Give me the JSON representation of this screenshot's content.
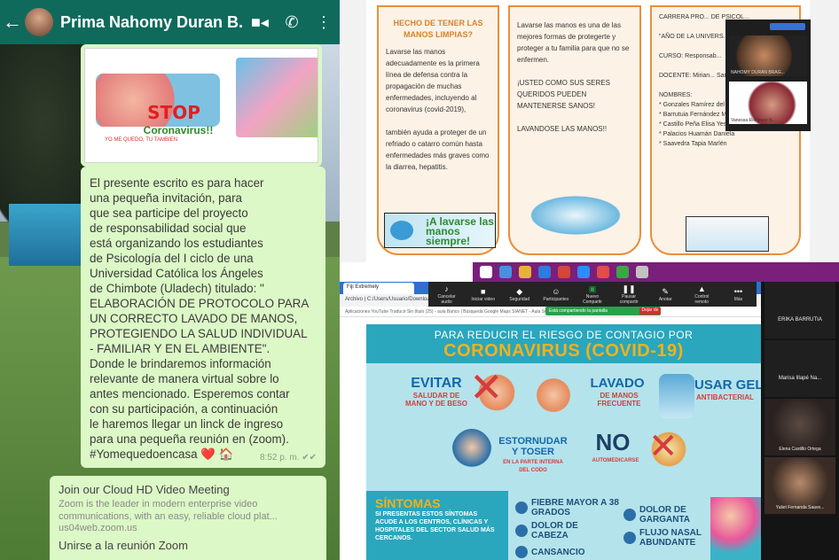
{
  "whatsapp": {
    "contact_name": "Prima Nahomy Duran B...",
    "poster": {
      "stop": "STOP",
      "coronavirus": "Coronavirus!!",
      "footer": "YO ME QUEDO, TU TAMBIEN"
    },
    "message": "El presente escrito es para hacer\nuna pequeña invitación, para\nque sea participe del proyecto\nde responsabilidad social que\nestá organizando los estudiantes\nde Psicología del I ciclo de una\nUniversidad Católica los Ángeles\nde Chimbote (Uladech) titulado: \"\nELABORACIÓN DE PROTOCOLO PARA\nUN CORRECTO LAVADO DE MANOS,\nPROTEGIENDO LA SALUD INDIVIDUAL\n- FAMILIAR Y EN EL AMBIENTE\".\nDonde le brindaremos información\nrelevante de manera virtual sobre lo\nantes mencionado. Esperemos contar\ncon su participación, a continuación\nle haremos llegar un linck de ingreso\npara una pequeña reunión en (zoom).\n#Yomequedoencasa ❤️ 🏠",
    "message_time": "8:52 p. m. ✔✔",
    "link_title": "Join our Cloud HD Video Meeting",
    "link_desc": "Zoom is the leader in modern enterprise video communications, with an easy, reliable cloud plat...",
    "link_url": "us04web.zoom.us",
    "link_join": "Unirse a la reunión Zoom"
  },
  "brochure": {
    "p1_heading": "HECHO DE TENER LAS MANOS LIMPIAS?",
    "p1_text": "Lavarse las manos adecuadamente es la primera línea de defensa contra la propagación de muchas enfermedades, incluyendo al coronavirus (covid-2019),\n\ntambién ayuda a proteger de un refriado o catarro común hasta enfermedades más graves como la diarrea, hepatitis.",
    "p1_image_text": "¡A lavarse las manos siempre!",
    "p2_text": "Lavarse las manos es una de las mejores formas de protegerte y proteger a tu familia para que no se enfermen.\n\n¡USTED COMO SUS SERES QUERIDOS PUEDEN MANTENERSE SANOS!\n\nLAVANDOSE LAS MANOS!!",
    "p3_text": "CARRERA PRO... DE PSICOL...\n\n\"AÑO DE LA UNIVERS... DE LA SALU...\"\n\nCURSO: Responsab...\n\nDOCENTE: Mirian... Santos Campaneza...\n\nNOMBRES:\n* Gonzales Ramírez del PILAR\n* Barrutuia Fernández Mayra\n* Castillo Peña Elisa Yesenia\n* Palacios Huamán Daniela\n* Saavedra Tapia Marlén",
    "zoom_names": [
      "NAHOMY DURAN BRAG...",
      "Vanessa Rodgiuez N..."
    ]
  },
  "browser": {
    "tab_label": "Fiji Extremely",
    "address": "Archivo | C:/Users/Usuario/Downloads",
    "bookmarks": "Aplicaciones  YouTube  Traducir  Sin título (25) - aula  Banco | Búsqueda  Google Maps  SIANET - Aula SGS  Google 2020",
    "zoom_controls": [
      "Cancelar audio",
      "Iniciar video",
      "Seguridad",
      "Participantes",
      "Nuevo Compartir",
      "Pausar compartir",
      "Anotar",
      "Control remoto",
      "Más"
    ],
    "share_text": "Está compartiendo la pantalla",
    "stop_text": "Dejar de",
    "infographic": {
      "subtitle": "PARA REDUCIR EL RIESGO DE CONTAGIO POR",
      "title": "CORONAVIRUS (COVID-19)",
      "evitar": "EVITAR",
      "evitar_sub": "SALUDAR DE MANO Y DE BESO",
      "lavado": "LAVADO",
      "lavado_sub": "DE MANOS FRECUENTE",
      "usar": "USAR GEL",
      "usar_sub": "ANTIBACTERIAL",
      "estornudar": "ESTORNUDAR Y TOSER",
      "estornudar_sub": "EN LA PARTE INTERNA DEL CODO",
      "no": "NO",
      "no_sub": "AUTOMEDICARSE",
      "sintomas_title": "SÍNTOMAS",
      "sintomas_text": "SI PRESENTAS ESTOS SÍNTOMAS ACUDE A LOS CENTROS, CLÍNICAS Y HOSPITALES DEL SECTOR SALUD MÁS CERCANOS.",
      "symptoms": [
        "FIEBRE MAYOR A 38 GRADOS",
        "DOLOR DE CABEZA",
        "CANSANCIO",
        "DOLOR DE GARGANTA",
        "FLUJO NASAL ABUNDANTE"
      ]
    },
    "participants": [
      "ERIKA BARRUTIA",
      "Marisa Illapé Na...",
      "Elena Castillo Ortega",
      "Yuliet Fernanda Saave..."
    ]
  }
}
